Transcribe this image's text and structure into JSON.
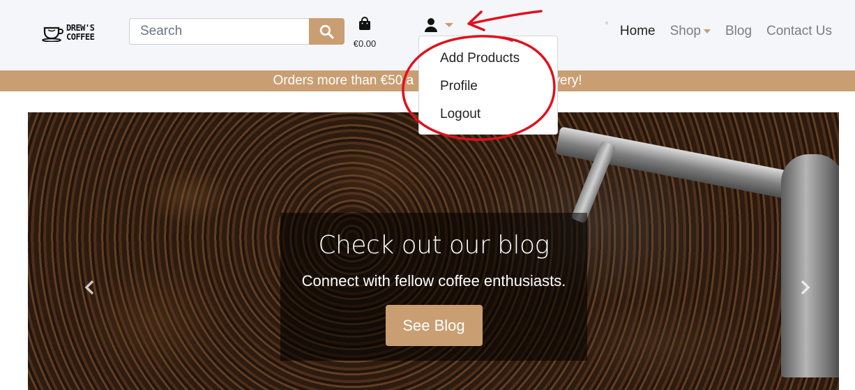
{
  "brand": {
    "line1": "DREW'S",
    "line2": "COFFEE"
  },
  "search": {
    "placeholder": "Search"
  },
  "cart": {
    "total": "€0.00"
  },
  "nav": [
    {
      "label": "Home",
      "active": true
    },
    {
      "label": "Shop",
      "has_caret": true
    },
    {
      "label": "Blog"
    },
    {
      "label": "Contact Us"
    }
  ],
  "user_menu": {
    "items": [
      "Add Products",
      "Profile",
      "Logout"
    ]
  },
  "banner": {
    "text": "Orders more than €50 a",
    "text_tail": "ivery!"
  },
  "hero": {
    "title": "Check out our blog",
    "subtitle": "Connect with fellow coffee enthusiasts.",
    "cta": "See Blog"
  },
  "colors": {
    "accent": "#c99e72",
    "header_bg": "#f4f6fa",
    "annotation": "#e0101c"
  }
}
